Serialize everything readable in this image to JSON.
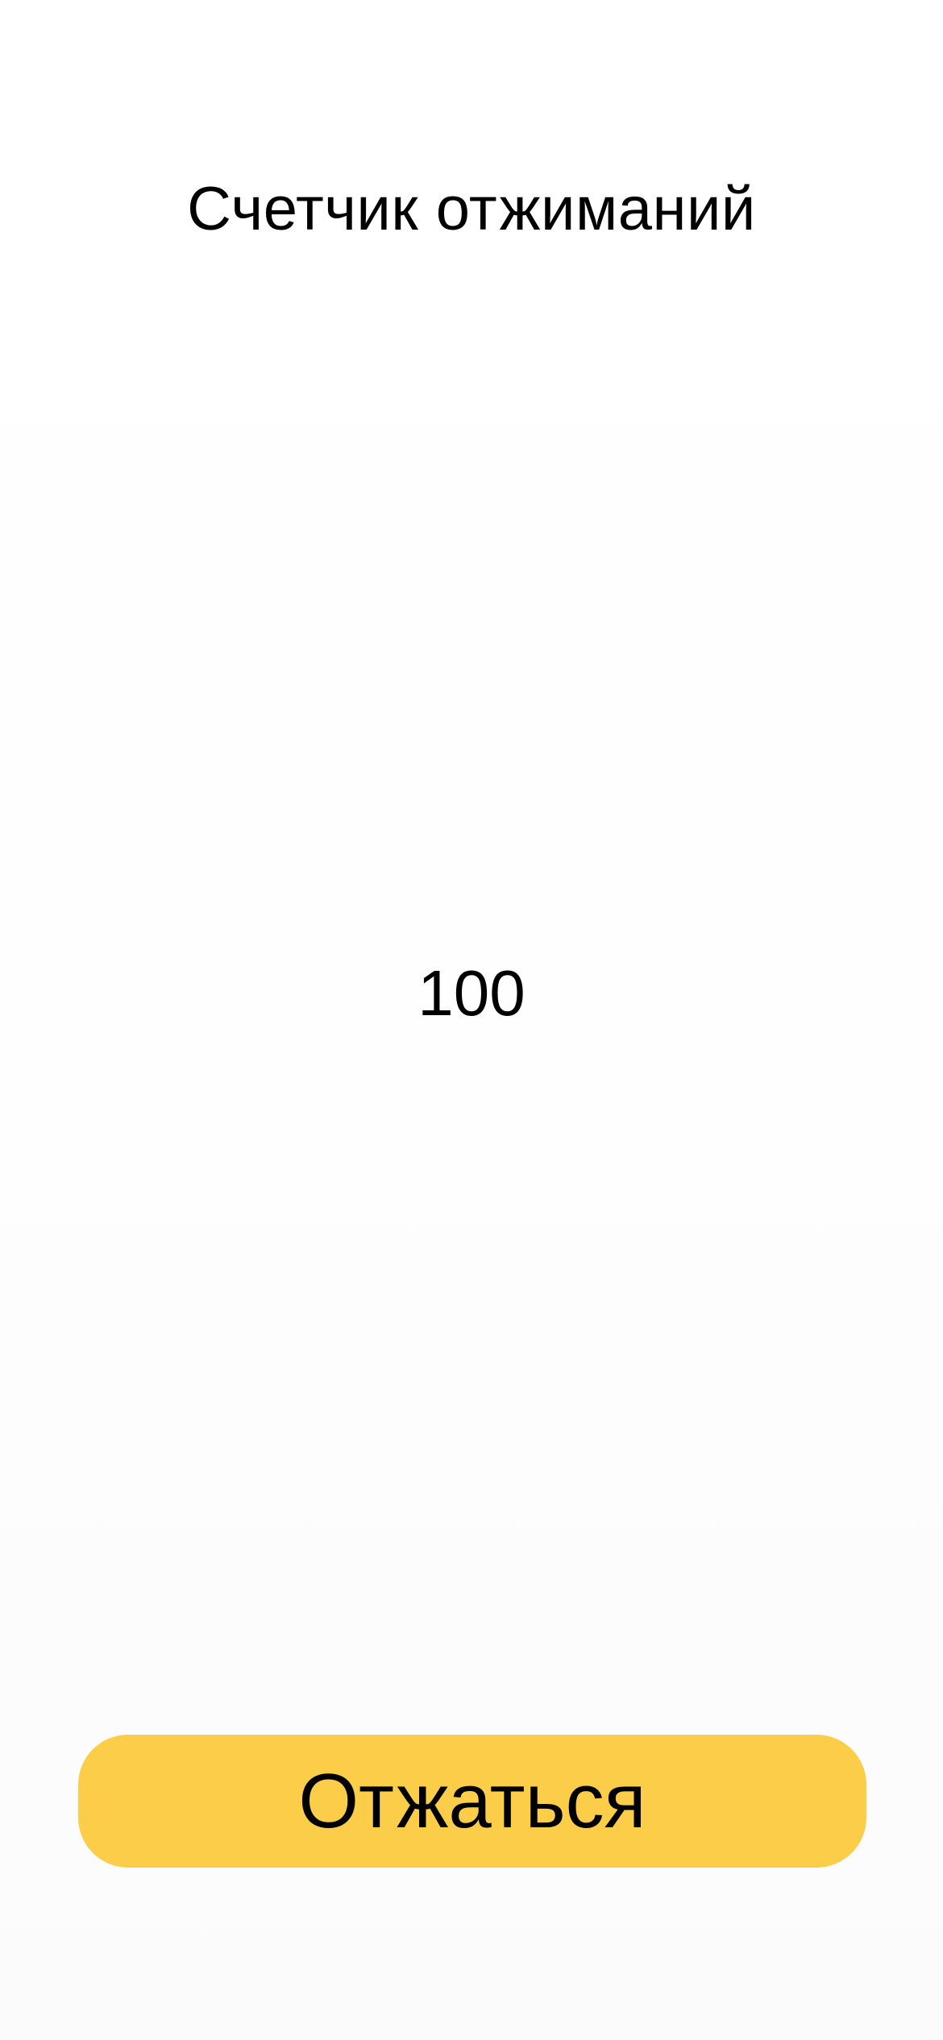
{
  "header": {
    "title": "Счетчик отжиманий"
  },
  "main": {
    "counter_value": "100"
  },
  "footer": {
    "action_label": "Отжаться"
  },
  "colors": {
    "background": "#ffffff",
    "button": "#fccd49",
    "text": "#000000"
  }
}
